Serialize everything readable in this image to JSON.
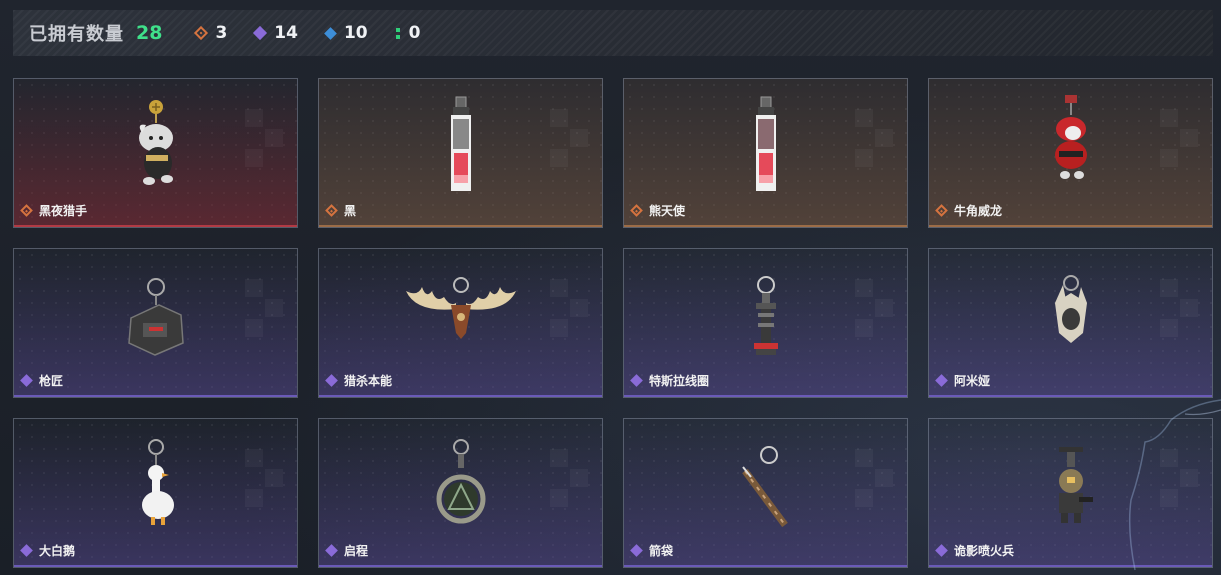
{
  "header": {
    "owned_label": "已拥有数量",
    "owned_count": "28",
    "stats": [
      {
        "rarity": "orange",
        "count": "3",
        "color": "#d5733f"
      },
      {
        "rarity": "purple",
        "count": "14",
        "color": "#8a6bd8"
      },
      {
        "rarity": "blue",
        "count": "10",
        "color": "#3d8ed8"
      },
      {
        "rarity": "green",
        "count": "0",
        "color": "#2fd07a"
      }
    ]
  },
  "items": [
    {
      "name": "黑夜猎手",
      "rarity": "orange",
      "icon": "cat-figure-charm-icon"
    },
    {
      "name": "黑",
      "rarity": "orange",
      "icon": "card-keychain-icon"
    },
    {
      "name": "熊天使",
      "rarity": "orange",
      "icon": "card-keychain-icon"
    },
    {
      "name": "牛角威龙",
      "rarity": "orange",
      "icon": "red-dragon-charm-icon"
    },
    {
      "name": "枪匠",
      "rarity": "purple",
      "icon": "gun-tag-charm-icon"
    },
    {
      "name": "猎杀本能",
      "rarity": "purple",
      "icon": "antler-charm-icon"
    },
    {
      "name": "特斯拉线圈",
      "rarity": "purple",
      "icon": "tesla-coil-charm-icon"
    },
    {
      "name": "阿米娅",
      "rarity": "purple",
      "icon": "bunny-charm-icon"
    },
    {
      "name": "大白鹅",
      "rarity": "purple",
      "icon": "goose-charm-icon"
    },
    {
      "name": "启程",
      "rarity": "purple",
      "icon": "medallion-charm-icon"
    },
    {
      "name": "箭袋",
      "rarity": "purple",
      "icon": "quiver-charm-icon"
    },
    {
      "name": "诡影喷火兵",
      "rarity": "purple",
      "icon": "flamethrower-soldier-charm-icon"
    }
  ]
}
